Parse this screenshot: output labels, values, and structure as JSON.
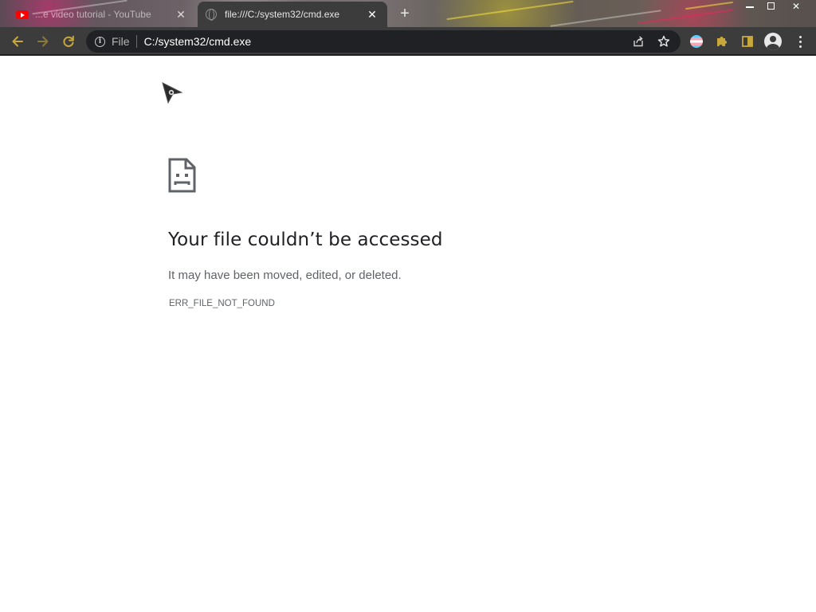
{
  "window": {
    "tabs": [
      {
        "title": "...e video tutorial - YouTube",
        "favicon": "youtube-icon",
        "active": false,
        "close_label": "✕"
      },
      {
        "title": "file:///C:/system32/cmd.exe",
        "favicon": "globe-icon",
        "active": true,
        "close_label": "✕"
      }
    ],
    "new_tab_label": "+",
    "controls": {
      "minimize": "minimize-icon",
      "maximize": "maximize-icon",
      "close": "✕"
    }
  },
  "toolbar": {
    "back_icon": "arrow-left-icon",
    "forward_icon": "arrow-right-icon",
    "reload_icon": "reload-icon",
    "omnibox": {
      "scheme_label": "File",
      "url": "C:/system32/cmd.exe",
      "share_icon": "share-icon",
      "bookmark_icon": "star-icon"
    },
    "extensions": [
      "trans-flag-extension-icon",
      "puzzle-extensions-icon",
      "side-panel-icon",
      "profile-icon",
      "kebab-menu-icon"
    ]
  },
  "page": {
    "icon": "sad-document-icon",
    "title": "Your file couldn’t be accessed",
    "description": "It may have been moved, edited, or deleted.",
    "error_code": "ERR_FILE_NOT_FOUND"
  },
  "colors": {
    "nav_icon_accent": "#c8a83a",
    "toolbar_bg": "#3c3c3c",
    "omnibox_bg": "#202124",
    "heading_text": "#202124",
    "body_text": "#5f6368"
  }
}
